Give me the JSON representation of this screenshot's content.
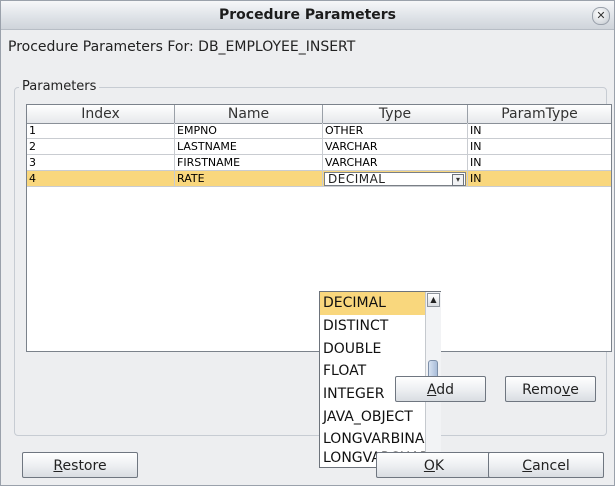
{
  "window": {
    "title": "Procedure Parameters",
    "close_icon": "close-icon"
  },
  "procedure_label": "Procedure Parameters For:  DB_EMPLOYEE_INSERT",
  "parameters_group": {
    "label": "Parameters"
  },
  "table": {
    "columns": [
      "Index",
      "Name",
      "Type",
      "ParamType"
    ],
    "rows": [
      {
        "index": "1",
        "name": "EMPNO",
        "type": "OTHER",
        "param_type": "IN"
      },
      {
        "index": "2",
        "name": "LASTNAME",
        "type": "VARCHAR",
        "param_type": "IN"
      },
      {
        "index": "3",
        "name": "FIRSTNAME",
        "type": "VARCHAR",
        "param_type": "IN"
      },
      {
        "index": "4",
        "name": "RATE",
        "type": "DECIMAL",
        "param_type": "IN",
        "selected": true
      }
    ]
  },
  "type_dropdown": {
    "options": [
      "DECIMAL",
      "DISTINCT",
      "DOUBLE",
      "FLOAT",
      "INTEGER",
      "JAVA_OBJECT",
      "LONGVARBINARY",
      "LONGVARCHAR"
    ],
    "selected": "DECIMAL"
  },
  "buttons": {
    "add": {
      "pre": "",
      "mnemonic": "A",
      "post": "dd"
    },
    "remove": {
      "pre": "Remo",
      "mnemonic": "v",
      "post": "e"
    },
    "restore": {
      "pre": "",
      "mnemonic": "R",
      "post": "estore"
    },
    "ok": {
      "pre": "",
      "mnemonic": "O",
      "post": "K"
    },
    "cancel": {
      "pre": "",
      "mnemonic": "C",
      "post": "ancel"
    }
  },
  "colors": {
    "selection": "#f9d77d",
    "dialog_bg": "#edeef0"
  }
}
